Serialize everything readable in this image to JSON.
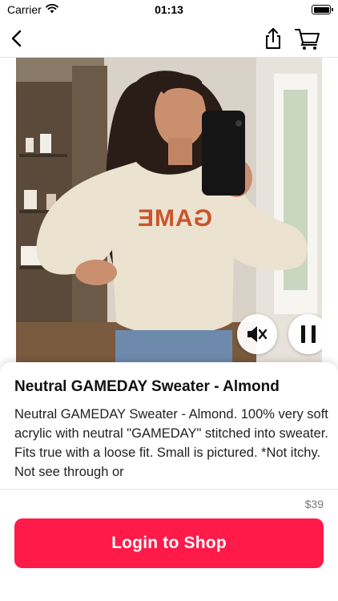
{
  "status_bar": {
    "carrier": "Carrier",
    "time": "01:13"
  },
  "nav": {
    "back_icon": "chevron-left-icon",
    "share_icon": "share-icon",
    "cart_icon": "cart-icon"
  },
  "media": {
    "sweater_print": "GAME",
    "mute_icon": "mute-icon",
    "pause_icon": "pause-icon"
  },
  "product": {
    "title": "Neutral GAMEDAY Sweater - Almond",
    "description": "Neutral GAMEDAY Sweater - Almond. 100% very soft acrylic with neutral \"GAMEDAY\" stitched into sweater. Fits true with a loose fit. Small is pictured. *Not itchy. Not see through or",
    "price": "$39"
  },
  "cta": {
    "label": "Login to Shop",
    "color": "#ff1a4a"
  }
}
